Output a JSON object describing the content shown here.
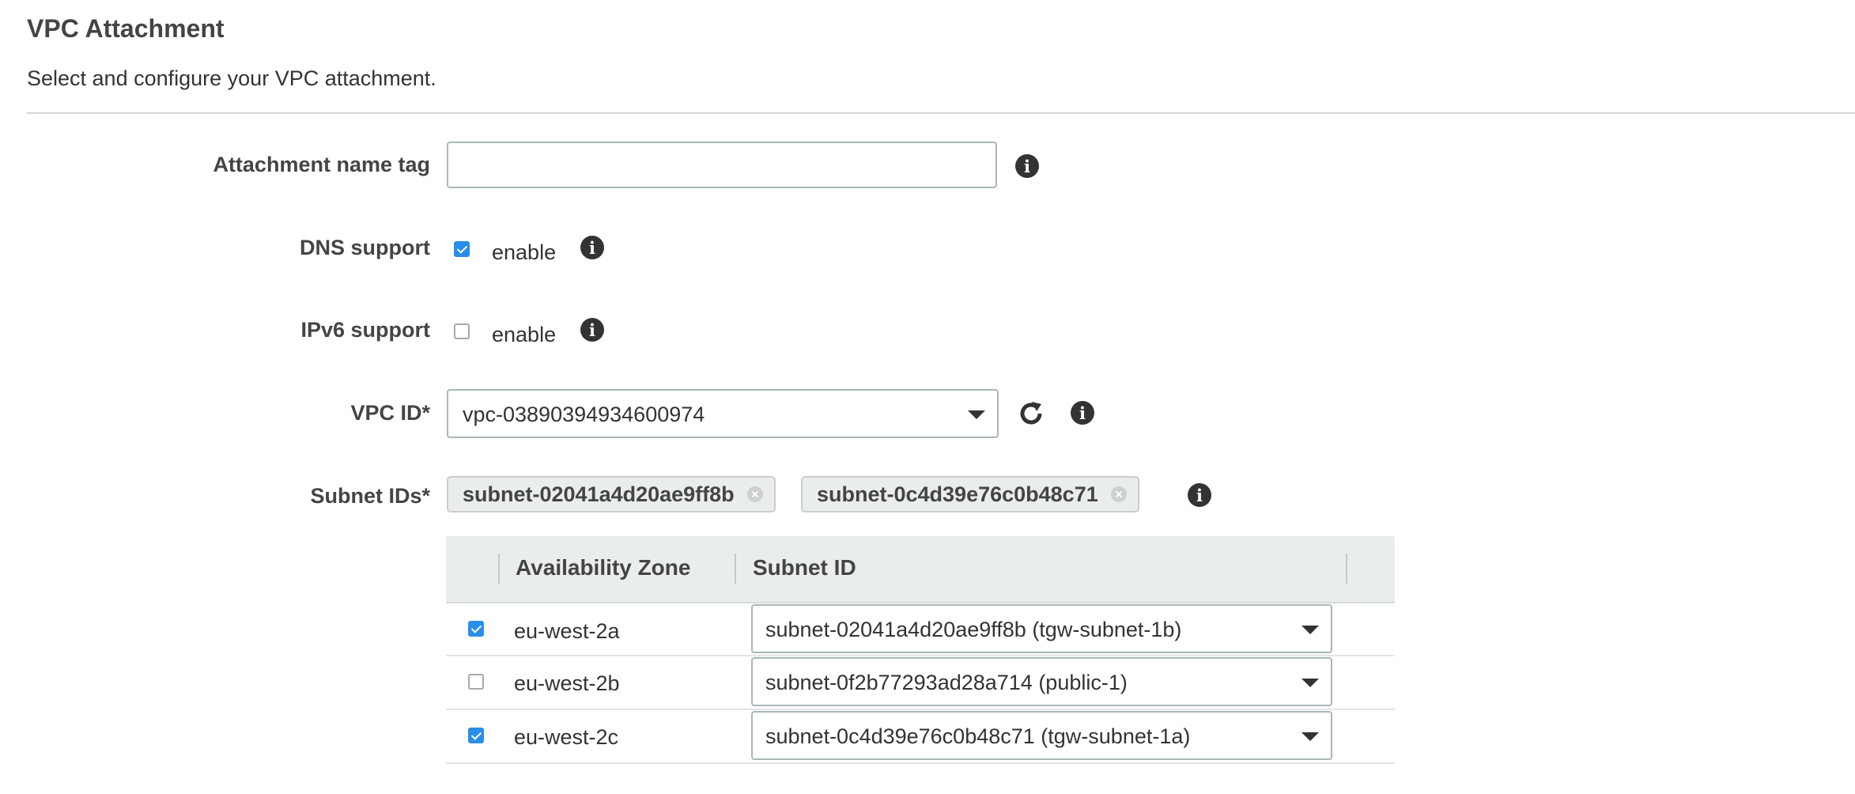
{
  "section": {
    "title": "VPC Attachment",
    "description": "Select and configure your VPC attachment."
  },
  "form": {
    "attachment_name": {
      "label": "Attachment name tag",
      "value": ""
    },
    "dns_support": {
      "label": "DNS support",
      "checkbox_label": "enable",
      "checked": true
    },
    "ipv6_support": {
      "label": "IPv6 support",
      "checkbox_label": "enable",
      "checked": false
    },
    "vpc_id": {
      "label": "VPC ID*",
      "value": "vpc-03890394934600974"
    },
    "subnet_ids": {
      "label": "Subnet IDs*",
      "tokens": [
        "subnet-02041a4d20ae9ff8b",
        "subnet-0c4d39e76c0b48c71"
      ]
    }
  },
  "subnet_table": {
    "columns": [
      "Availability Zone",
      "Subnet ID"
    ],
    "rows": [
      {
        "checked": true,
        "zone": "eu-west-2a",
        "subnet": "subnet-02041a4d20ae9ff8b (tgw-subnet-1b)"
      },
      {
        "checked": false,
        "zone": "eu-west-2b",
        "subnet": "subnet-0f2b77293ad28a714 (public-1)"
      },
      {
        "checked": true,
        "zone": "eu-west-2c",
        "subnet": "subnet-0c4d39e76c0b48c71 (tgw-subnet-1a)"
      }
    ]
  },
  "icons": {
    "info": "info-icon",
    "refresh": "refresh-icon",
    "dropdown": "caret-down-icon",
    "remove": "remove-token-icon"
  },
  "colors": {
    "checkbox_checked": "#2a8ee8",
    "token_bg": "#eaeded",
    "table_header_bg": "#eaeded",
    "input_border": "#aab7b8"
  }
}
